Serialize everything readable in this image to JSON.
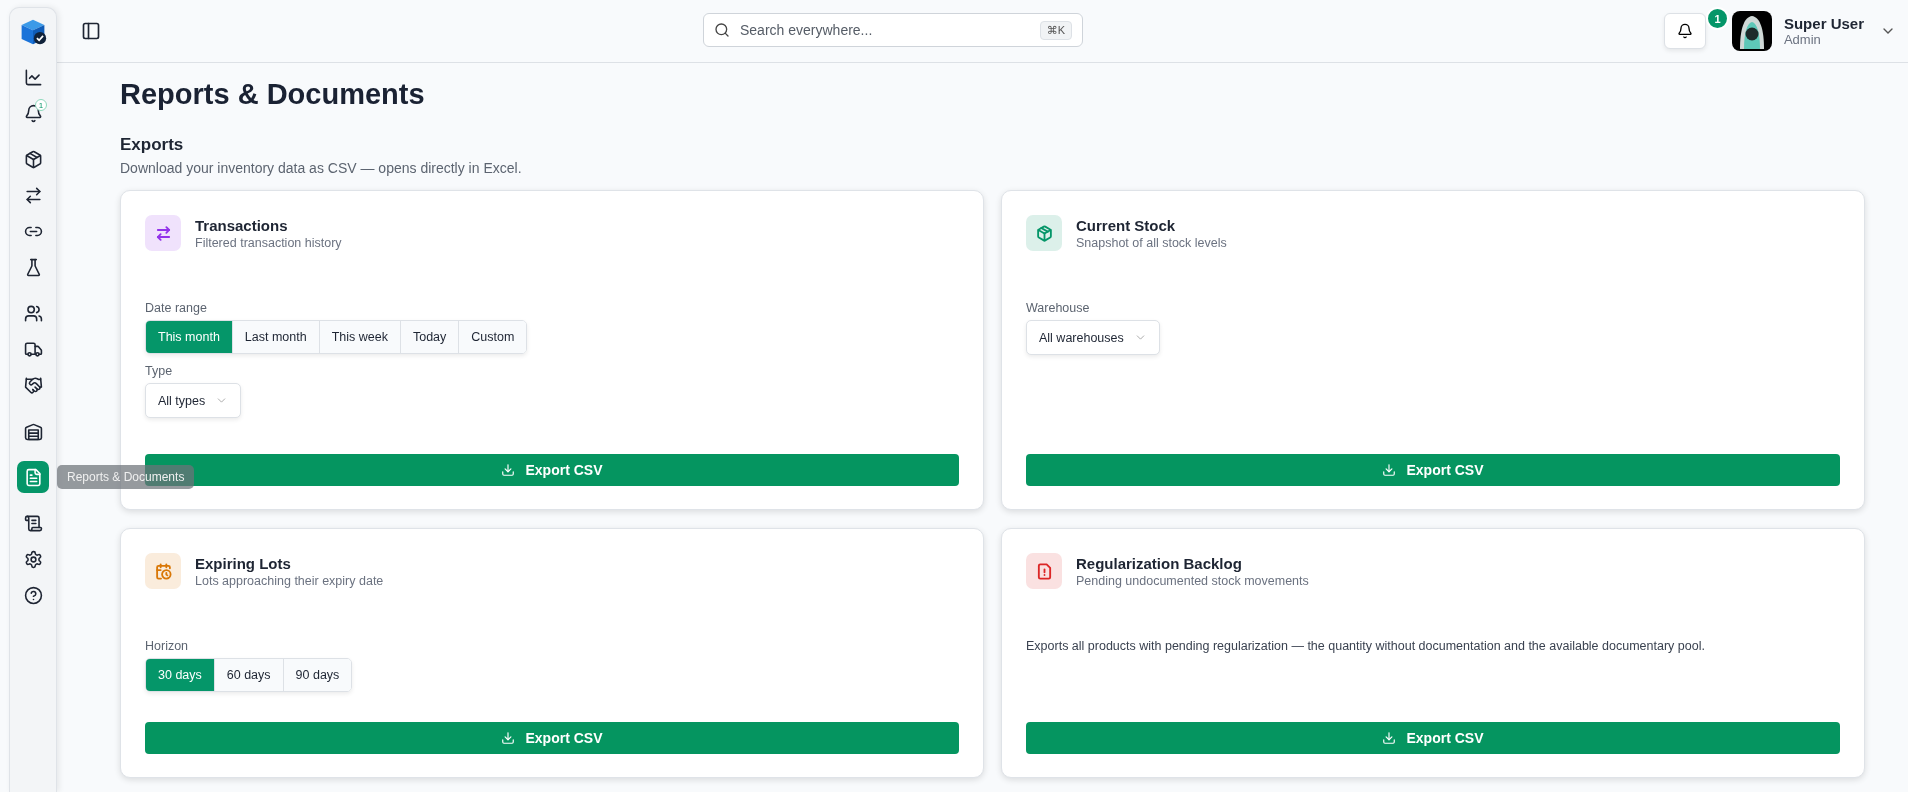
{
  "sidebar": {
    "groups": [
      {
        "items": [
          {
            "selected": false
          },
          {
            "selected": false,
            "badge": "1"
          }
        ]
      },
      {
        "items": [
          {
            "selected": false
          },
          {
            "selected": false
          },
          {
            "selected": false
          },
          {
            "selected": false
          }
        ]
      },
      {
        "items": [
          {
            "selected": false
          },
          {
            "selected": false
          },
          {
            "selected": false
          }
        ]
      },
      {
        "items": [
          {
            "selected": false
          }
        ]
      },
      {
        "items": [
          {
            "selected": true
          }
        ]
      },
      {
        "items": [
          {
            "selected": false
          },
          {
            "selected": false
          },
          {
            "selected": false
          }
        ]
      }
    ],
    "tooltip": "Reports & Documents"
  },
  "header": {
    "search": {
      "placeholder": "Search everywhere...",
      "shortcut": "⌘K"
    },
    "notifications": {
      "badge": "1"
    },
    "user": {
      "name": "Super User",
      "role": "Admin"
    }
  },
  "page": {
    "title": "Reports & Documents",
    "section": {
      "title": "Exports",
      "description": "Download your inventory data as CSV — opens directly in Excel."
    }
  },
  "cards": [
    {
      "title": "Transactions",
      "subtitle": "Filtered transaction history",
      "color": "#9333ea",
      "fields": [
        {
          "kind": "segmented",
          "label": "Date range",
          "options": [
            {
              "label": "This month",
              "selected": true
            },
            {
              "label": "Last month",
              "selected": false
            },
            {
              "label": "This week",
              "selected": false
            },
            {
              "label": "Today",
              "selected": false
            },
            {
              "label": "Custom",
              "selected": false
            }
          ]
        },
        {
          "kind": "select",
          "label": "Type",
          "value": "All types"
        }
      ],
      "button": "Export CSV"
    },
    {
      "title": "Current Stock",
      "subtitle": "Snapshot of all stock levels",
      "color": "#059669",
      "fields": [
        {
          "kind": "select",
          "label": "Warehouse",
          "value": "All warehouses"
        }
      ],
      "button": "Export CSV"
    },
    {
      "title": "Expiring Lots",
      "subtitle": "Lots approaching their expiry date",
      "color": "#d97706",
      "fields": [
        {
          "kind": "segmented",
          "label": "Horizon",
          "options": [
            {
              "label": "30 days",
              "selected": true
            },
            {
              "label": "60 days",
              "selected": false
            },
            {
              "label": "90 days",
              "selected": false
            }
          ]
        }
      ],
      "button": "Export CSV"
    },
    {
      "title": "Regularization Backlog",
      "subtitle": "Pending undocumented stock movements",
      "color": "#dc2626",
      "fields": [
        {
          "kind": "text",
          "text": "Exports all products with pending regularization — the quantity without documentation and the available documentary pool."
        }
      ],
      "button": "Export CSV"
    }
  ]
}
